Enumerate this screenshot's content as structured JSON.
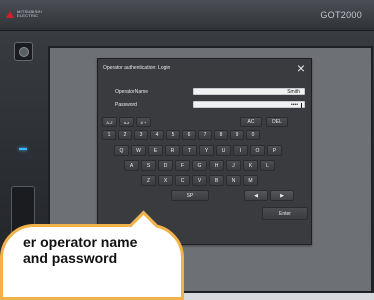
{
  "device": {
    "brand": "MITSUBISHI ELECTRIC",
    "model": "GOT2000"
  },
  "dialog": {
    "title": "Operator authentication: Login",
    "fields": [
      {
        "label": "OperatorName",
        "value": "Smith",
        "placeholder": ""
      },
      {
        "label": "Password",
        "value": "••••",
        "placeholder": ""
      }
    ]
  },
  "keyboard": {
    "mode_keys": [
      "A-Z",
      "a-z",
      "# +"
    ],
    "control_keys": {
      "ac": "AC",
      "del": "DEL"
    },
    "row_numbers": [
      "1",
      "2",
      "3",
      "4",
      "5",
      "6",
      "7",
      "8",
      "9",
      "0"
    ],
    "row_q": [
      "Q",
      "W",
      "E",
      "R",
      "T",
      "Y",
      "U",
      "I",
      "O",
      "P"
    ],
    "row_a": [
      "A",
      "S",
      "D",
      "F",
      "G",
      "H",
      "J",
      "K",
      "L"
    ],
    "row_z": [
      "Z",
      "X",
      "C",
      "V",
      "B",
      "N",
      "M"
    ],
    "space": "SP",
    "arrows": {
      "left": "◀",
      "right": "▶"
    },
    "enter": "Enter"
  },
  "callout": {
    "line1": "er operator name",
    "line2": "and password"
  },
  "colors": {
    "bezel": "#2a2d31",
    "screen": "#6d7075",
    "dialog": "#3a3b3e",
    "led": "#39b8ff",
    "callout_border": "#f2b24a"
  }
}
